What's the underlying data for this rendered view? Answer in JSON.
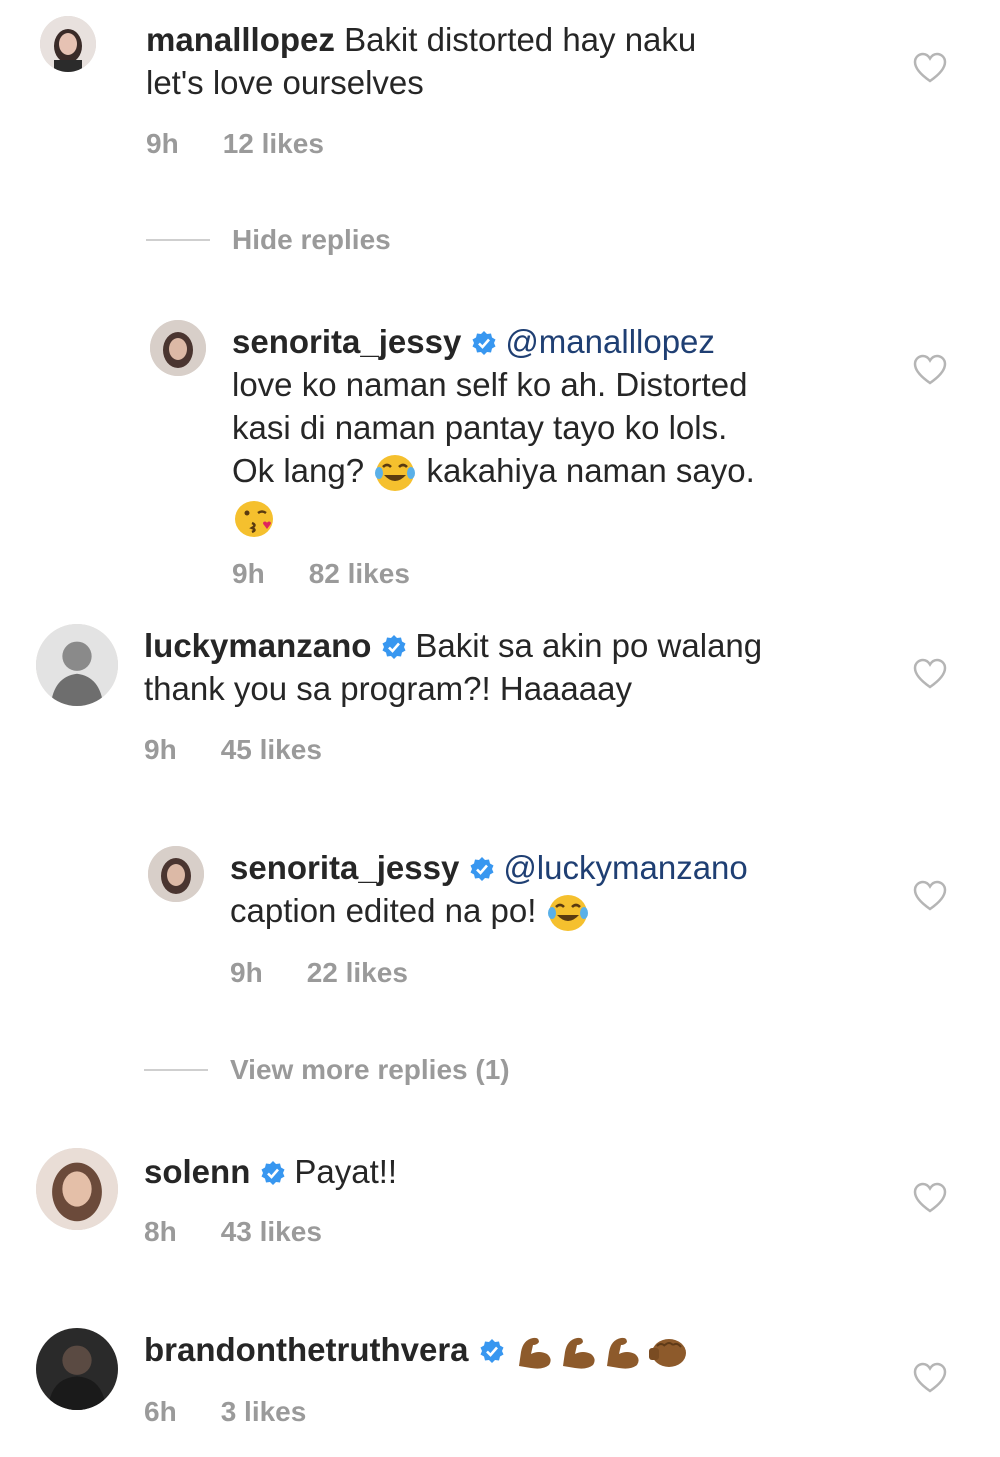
{
  "comments": [
    {
      "username": "manalllopez",
      "text_line1": "Bakit distorted hay naku",
      "text_line2": "let's love ourselves",
      "time": "9h",
      "likes": "12 likes"
    },
    {
      "hide_replies": "Hide replies",
      "username": "senorita_jessy",
      "mention": "@manalllopez",
      "line2": "love ko naman self ko ah. Distorted",
      "line3": "kasi di naman pantay tayo ko lols.",
      "line4a": "Ok lang?",
      "line4b": "kakahiya naman sayo.",
      "time": "9h",
      "likes": "82 likes"
    },
    {
      "username": "luckymanzano",
      "text_line1": "Bakit sa akin po walang",
      "text_line2": "thank you sa program?! Haaaaay",
      "time": "9h",
      "likes": "45 likes"
    },
    {
      "username": "senorita_jessy",
      "mention": "@luckymanzano",
      "line2": "caption edited na po!",
      "time": "9h",
      "likes": "22 likes",
      "view_more": "View more replies (1)"
    },
    {
      "username": "solenn",
      "text": "Payat!!",
      "time": "8h",
      "likes": "43 likes"
    },
    {
      "username": "brandonthetruthvera",
      "time": "6h",
      "likes": "3 likes"
    }
  ],
  "icons": {
    "heart": "heart-outline-icon",
    "verified": "verified-badge-icon",
    "laugh_emoji": "laughing-crying-emoji",
    "kiss_emoji": "kissing-emoji",
    "muscle_emoji": "flexed-biceps-emoji",
    "fist_emoji": "fist-emoji"
  },
  "colors": {
    "verified_blue": "#3897f0",
    "meta_gray": "#9a9a9a",
    "text": "#262626"
  }
}
